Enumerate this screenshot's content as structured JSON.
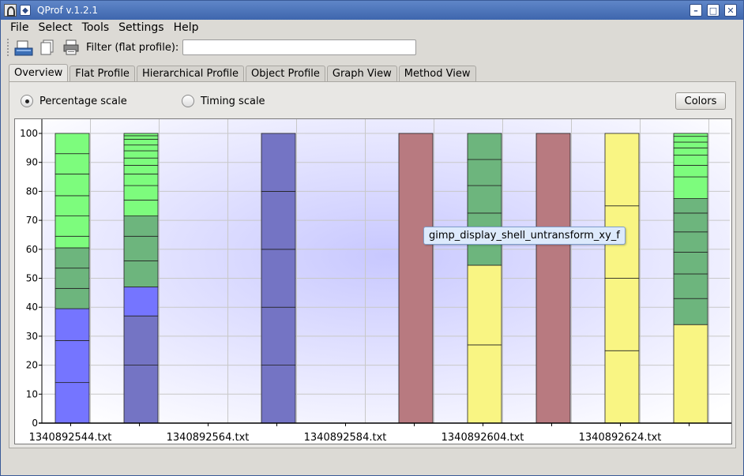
{
  "window": {
    "title": "QProf v.1.2.1",
    "controls": [
      "minimize",
      "maximize",
      "close"
    ]
  },
  "menu": {
    "file": "File",
    "select": "Select",
    "tools": "Tools",
    "settings": "Settings",
    "help": "Help"
  },
  "toolbar": {
    "icons": [
      "open-icon",
      "copy-icon",
      "print-icon"
    ],
    "filter_label": "Filter (flat profile):",
    "filter_value": ""
  },
  "tabs": [
    {
      "label": "Overview",
      "active": true
    },
    {
      "label": "Flat Profile",
      "active": false
    },
    {
      "label": "Hierarchical Profile",
      "active": false
    },
    {
      "label": "Object Profile",
      "active": false
    },
    {
      "label": "Graph View",
      "active": false
    },
    {
      "label": "Method View",
      "active": false
    }
  ],
  "options": {
    "percentage_scale": "Percentage scale",
    "timing_scale": "Timing scale",
    "selected": "percentage",
    "colors_button": "Colors"
  },
  "tooltip": "gimp_display_shell_untransform_xy_f",
  "colors": {
    "blue": "#7575ff",
    "slate": "#7474c4",
    "green": "#7dfc7d",
    "dark_green": "#6db57d",
    "rose": "#b87a80",
    "yellow": "#f9f583"
  },
  "chart_data": {
    "type": "bar",
    "stacked": true,
    "ylim": [
      0,
      100
    ],
    "yticks": [
      0,
      10,
      20,
      30,
      40,
      50,
      60,
      70,
      80,
      90,
      100
    ],
    "xlabels": [
      "1340892544.txt",
      "1340892564.txt",
      "1340892584.txt",
      "1340892604.txt",
      "1340892624.txt"
    ],
    "grid": true,
    "bars": [
      {
        "segments": [
          {
            "from": 0,
            "to": 14,
            "color": "blue"
          },
          {
            "from": 14,
            "to": 28.5,
            "color": "blue"
          },
          {
            "from": 28.5,
            "to": 39.5,
            "color": "blue"
          },
          {
            "from": 39.5,
            "to": 46.5,
            "color": "dark_green"
          },
          {
            "from": 46.5,
            "to": 53.5,
            "color": "dark_green"
          },
          {
            "from": 53.5,
            "to": 60.5,
            "color": "dark_green"
          },
          {
            "from": 60.5,
            "to": 64.5,
            "color": "green"
          },
          {
            "from": 64.5,
            "to": 71.5,
            "color": "green"
          },
          {
            "from": 71.5,
            "to": 78.5,
            "color": "green"
          },
          {
            "from": 78.5,
            "to": 86,
            "color": "green"
          },
          {
            "from": 86,
            "to": 93,
            "color": "green"
          },
          {
            "from": 93,
            "to": 100,
            "color": "green"
          }
        ]
      },
      {
        "segments": [
          {
            "from": 0,
            "to": 20,
            "color": "slate"
          },
          {
            "from": 20,
            "to": 37,
            "color": "slate"
          },
          {
            "from": 37,
            "to": 47,
            "color": "blue"
          },
          {
            "from": 47,
            "to": 56,
            "color": "dark_green"
          },
          {
            "from": 56,
            "to": 64.5,
            "color": "dark_green"
          },
          {
            "from": 64.5,
            "to": 71.5,
            "color": "dark_green"
          },
          {
            "from": 71.5,
            "to": 77,
            "color": "green"
          },
          {
            "from": 77,
            "to": 82,
            "color": "green"
          },
          {
            "from": 82,
            "to": 86,
            "color": "green"
          },
          {
            "from": 86,
            "to": 89,
            "color": "green"
          },
          {
            "from": 89,
            "to": 91.5,
            "color": "green"
          },
          {
            "from": 91.5,
            "to": 94,
            "color": "green"
          },
          {
            "from": 94,
            "to": 96,
            "color": "green"
          },
          {
            "from": 96,
            "to": 98,
            "color": "green"
          },
          {
            "from": 98,
            "to": 99.2,
            "color": "green"
          },
          {
            "from": 99.2,
            "to": 100,
            "color": "green"
          }
        ]
      },
      {
        "segments": []
      },
      {
        "segments": [
          {
            "from": 0,
            "to": 20,
            "color": "slate"
          },
          {
            "from": 20,
            "to": 40,
            "color": "slate"
          },
          {
            "from": 40,
            "to": 60,
            "color": "slate"
          },
          {
            "from": 60,
            "to": 80,
            "color": "slate"
          },
          {
            "from": 80,
            "to": 100,
            "color": "slate"
          }
        ]
      },
      {
        "segments": []
      },
      {
        "segments": [
          {
            "from": 0,
            "to": 100,
            "color": "rose"
          }
        ]
      },
      {
        "segments": [
          {
            "from": 0,
            "to": 27,
            "color": "yellow"
          },
          {
            "from": 27,
            "to": 54.5,
            "color": "yellow"
          },
          {
            "from": 54.5,
            "to": 63.5,
            "color": "dark_green"
          },
          {
            "from": 63.5,
            "to": 72.5,
            "color": "dark_green"
          },
          {
            "from": 72.5,
            "to": 82,
            "color": "dark_green"
          },
          {
            "from": 82,
            "to": 91,
            "color": "dark_green"
          },
          {
            "from": 91,
            "to": 100,
            "color": "dark_green"
          }
        ]
      },
      {
        "segments": [
          {
            "from": 0,
            "to": 100,
            "color": "rose"
          }
        ]
      },
      {
        "segments": [
          {
            "from": 0,
            "to": 25,
            "color": "yellow"
          },
          {
            "from": 25,
            "to": 50,
            "color": "yellow"
          },
          {
            "from": 50,
            "to": 75,
            "color": "yellow"
          },
          {
            "from": 75,
            "to": 100,
            "color": "yellow"
          }
        ]
      },
      {
        "segments": [
          {
            "from": 0,
            "to": 34,
            "color": "yellow"
          },
          {
            "from": 34,
            "to": 43,
            "color": "dark_green"
          },
          {
            "from": 43,
            "to": 51.5,
            "color": "dark_green"
          },
          {
            "from": 51.5,
            "to": 59,
            "color": "dark_green"
          },
          {
            "from": 59,
            "to": 66,
            "color": "dark_green"
          },
          {
            "from": 66,
            "to": 72.5,
            "color": "dark_green"
          },
          {
            "from": 72.5,
            "to": 77.5,
            "color": "dark_green"
          },
          {
            "from": 77.5,
            "to": 85,
            "color": "green"
          },
          {
            "from": 85,
            "to": 89,
            "color": "green"
          },
          {
            "from": 89,
            "to": 92.5,
            "color": "green"
          },
          {
            "from": 92.5,
            "to": 95,
            "color": "green"
          },
          {
            "from": 95,
            "to": 97,
            "color": "green"
          },
          {
            "from": 97,
            "to": 99,
            "color": "green"
          },
          {
            "from": 99,
            "to": 100,
            "color": "green"
          }
        ]
      }
    ]
  }
}
